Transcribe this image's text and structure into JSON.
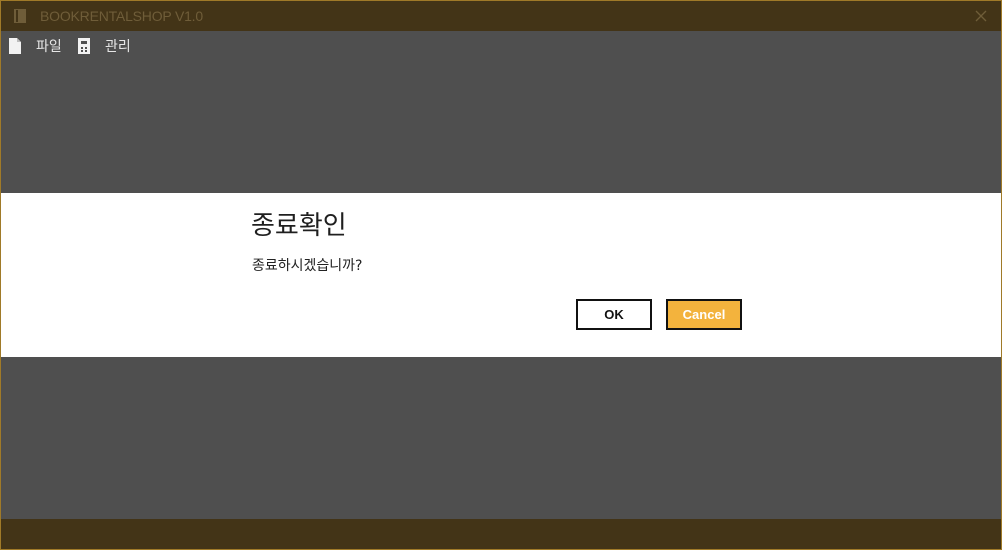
{
  "window": {
    "title": "BOOKRENTALSHOP V1.0",
    "accent_color": "#433417",
    "border_color": "#a07a28",
    "background_color": "#4f4f4f"
  },
  "menu": {
    "items": [
      {
        "label": "파일",
        "icon": "file-icon"
      },
      {
        "label": "관리",
        "icon": "admin-icon"
      }
    ]
  },
  "dialog": {
    "title": "종료확인",
    "message": "종료하시겠습니까?",
    "ok_label": "OK",
    "cancel_label": "Cancel",
    "cancel_color": "#f3b33d"
  }
}
